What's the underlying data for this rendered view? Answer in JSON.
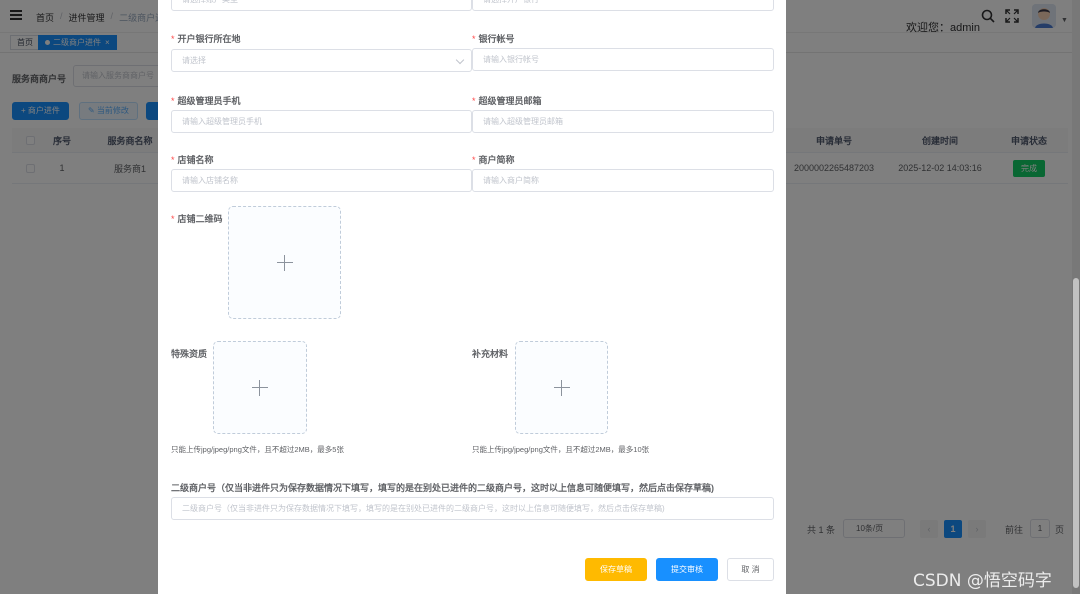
{
  "navbar": {
    "breadcrumb": [
      "首页",
      "进件管理",
      "二级商户进件"
    ],
    "welcome_prefix": "欢迎您：",
    "username": "admin"
  },
  "tags": [
    {
      "label": "首页",
      "active": false
    },
    {
      "label": "二级商户进件",
      "active": true
    }
  ],
  "filter": {
    "label": "服务商商户号",
    "placeholder": "请输入服务商商户号"
  },
  "toolbar": {
    "add_label": "+ 商户进件",
    "edit_label": "✎ 当前修改"
  },
  "table": {
    "headers": {
      "index": "序号",
      "provider": "服务商名称",
      "apply_no": "申请单号",
      "created": "创建时间",
      "status": "申请状态"
    },
    "rows": [
      {
        "index": "1",
        "provider": "服务商1",
        "apply_no": "2000002265487203",
        "created": "2025-12-02 14:03:16",
        "status": "完成"
      }
    ]
  },
  "pagination": {
    "total": "共 1 条",
    "page_size": "10条/页",
    "current_page": "1",
    "goto_label": "前往",
    "goto_value": "1",
    "page_unit": "页"
  },
  "dialog": {
    "top_left_placeholder": "请选择账户类型",
    "top_right_placeholder": "请选择开户银行",
    "bank_region": {
      "label": "开户银行所在地",
      "placeholder": "请选择"
    },
    "bank_account": {
      "label": "银行帐号",
      "placeholder": "请输入银行帐号"
    },
    "admin_phone": {
      "label": "超级管理员手机",
      "placeholder": "请输入超级管理员手机"
    },
    "admin_email": {
      "label": "超级管理员邮箱",
      "placeholder": "请输入超级管理员邮箱"
    },
    "store_name": {
      "label": "店铺名称",
      "placeholder": "请输入店铺名称"
    },
    "merchant_short": {
      "label": "商户简称",
      "placeholder": "请输入商户简称"
    },
    "store_qrcode": {
      "label": "店铺二维码"
    },
    "special_qual": {
      "label": "特殊资质",
      "hint": "只能上传jpg/jpeg/png文件，且不超过2MB，最多5张"
    },
    "extra_material": {
      "label": "补充材料",
      "hint": "只能上传jpg/jpeg/png文件，且不超过2MB，最多10张"
    },
    "sub_merchant_no": {
      "label": "二级商户号（仅当非进件只为保存数据情况下填写，填写的是在别处已进件的二级商户号，这时以上信息可随便填写，然后点击保存草稿)",
      "placeholder": "二级商户号（仅当非进件只为保存数据情况下填写，填写的是在别处已进件的二级商户号，这时以上信息可随便填写，然后点击保存草稿)"
    },
    "buttons": {
      "save_draft": "保存草稿",
      "submit": "提交审核",
      "cancel": "取 消"
    }
  },
  "watermark": "CSDN @悟空码字",
  "colors": {
    "primary": "#1890ff",
    "warning": "#ffba00",
    "success": "#13ce66",
    "required": "#ff4949"
  }
}
